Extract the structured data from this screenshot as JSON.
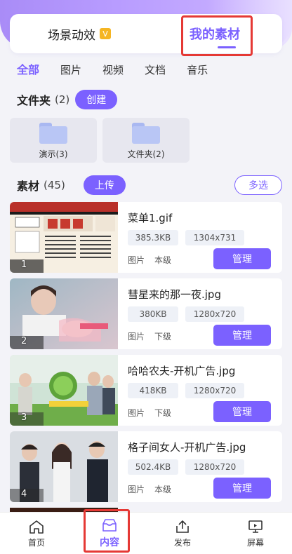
{
  "header": {
    "tabs": [
      {
        "label": "场景动效",
        "badge": "V"
      },
      {
        "label": "我的素材"
      }
    ]
  },
  "categories": [
    "全部",
    "图片",
    "视频",
    "文档",
    "音乐"
  ],
  "folders_section": {
    "title": "文件夹",
    "count": "(2)",
    "create_label": "创建",
    "items": [
      {
        "label": "演示(3)"
      },
      {
        "label": "文件夹(2)"
      }
    ]
  },
  "materials_section": {
    "title": "素材",
    "count": "(45)",
    "upload_label": "上传",
    "multi_select_label": "多选",
    "items": [
      {
        "index": "1",
        "name": "菜单1.gif",
        "size": "385.3KB",
        "resolution": "1304x731",
        "type": "图片",
        "level": "本级",
        "manage_label": "管理"
      },
      {
        "index": "2",
        "name": "彗星来的那一夜.jpg",
        "size": "380KB",
        "resolution": "1280x720",
        "type": "图片",
        "level": "下级",
        "manage_label": "管理"
      },
      {
        "index": "3",
        "name": "哈哈农夫-开机广告.jpg",
        "size": "418KB",
        "resolution": "1280x720",
        "type": "图片",
        "level": "下级",
        "manage_label": "管理"
      },
      {
        "index": "4",
        "name": "格子间女人-开机广告.jpg",
        "size": "502.4KB",
        "resolution": "1280x720",
        "type": "图片",
        "level": "本级",
        "manage_label": "管理"
      }
    ]
  },
  "bottom_nav": [
    {
      "label": "首页",
      "icon": "home-icon"
    },
    {
      "label": "内容",
      "icon": "content-box-icon"
    },
    {
      "label": "发布",
      "icon": "publish-icon"
    },
    {
      "label": "屏幕",
      "icon": "screen-icon"
    }
  ],
  "colors": {
    "accent": "#7b61ff",
    "highlight": "#e53935",
    "vip": "#f5b523"
  }
}
